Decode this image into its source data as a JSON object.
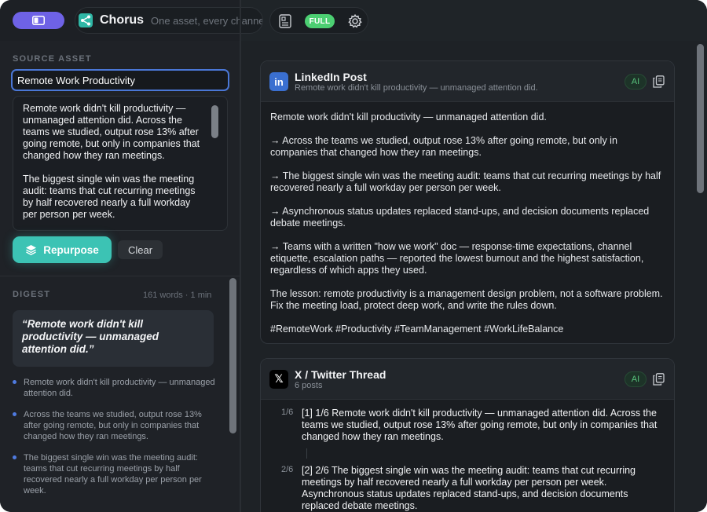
{
  "app": {
    "name": "Chorus",
    "tagline": "One asset, every channel",
    "mode_badge": "FULL"
  },
  "source": {
    "section_label": "SOURCE ASSET",
    "title_value": "Remote Work Productivity",
    "body_paragraphs": [
      "Remote work didn't kill productivity — unmanaged attention did. Across the teams we studied, output rose 13% after going remote, but only in companies that changed how they ran meetings.",
      "The biggest single win was the meeting audit: teams that cut recurring meetings by half recovered nearly a full workday per person per week."
    ],
    "repurpose_label": "Repurpose",
    "clear_label": "Clear"
  },
  "digest": {
    "section_label": "DIGEST",
    "meta": "161 words · 1 min",
    "quote": "“Remote work didn't kill productivity — unmanaged attention did.”",
    "items": [
      "Remote work didn't kill productivity — unmanaged attention did.",
      "Across the teams we studied, output rose 13% after going remote, but only in companies that changed how they ran meetings.",
      "The biggest single win was the meeting audit: teams that cut recurring meetings by half recovered nearly a full workday per person per week."
    ]
  },
  "linkedin": {
    "icon_text": "in",
    "title": "LinkedIn Post",
    "subtitle": "Remote work didn't kill productivity — unmanaged attention did.",
    "ai_badge": "AI",
    "paragraphs": [
      "Remote work didn't kill productivity — unmanaged attention did.",
      "→ Across the teams we studied, output rose 13% after going remote, but only in companies that changed how they ran meetings.",
      "→ The biggest single win was the meeting audit: teams that cut recurring meetings by half recovered nearly a full workday per person per week.",
      "→ Asynchronous status updates replaced stand-ups, and decision documents replaced debate meetings.",
      "→ Teams with a written \"how we work\" doc — response-time expectations, channel etiquette, escalation paths — reported the lowest burnout and the highest satisfaction, regardless of which apps they used.",
      "The lesson: remote productivity is a management design problem, not a software problem. Fix the meeting load, protect deep work, and write the rules down.",
      "#RemoteWork #Productivity #TeamManagement #WorkLifeBalance"
    ]
  },
  "twitter": {
    "icon_text": "𝕏",
    "title": "X / Twitter Thread",
    "subtitle": "6 posts",
    "ai_badge": "AI",
    "posts": [
      {
        "num": "1/6",
        "text": "[1] 1/6 Remote work didn't kill productivity — unmanaged attention did. Across the teams we studied, output rose 13% after going remote, but only in companies that changed how they ran meetings."
      },
      {
        "num": "2/6",
        "text": "[2] 2/6 The biggest single win was the meeting audit: teams that cut recurring meetings by half recovered nearly a full workday per person per week. Asynchronous status updates replaced stand-ups, and decision documents replaced debate meetings."
      }
    ]
  },
  "colors": {
    "accent_purple": "#6e62e6",
    "accent_teal": "#3cc3b4",
    "badge_green": "#4ccf72",
    "linkedin_blue": "#3a6fd0",
    "focus_blue": "#4a77d6"
  },
  "icons": {
    "sidebar_toggle": "sidebar-icon",
    "logo": "share-nodes-icon",
    "doc": "document-icon",
    "settings": "gear-icon",
    "repurpose": "layers-icon",
    "copy": "copy-icon"
  }
}
